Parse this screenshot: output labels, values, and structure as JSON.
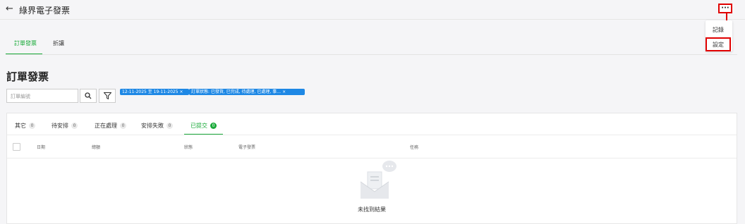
{
  "header": {
    "back_icon": "arrow-left-icon",
    "title": "綠界電子發票",
    "more_icon": "ellipsis-icon",
    "more_label": "···"
  },
  "dropdown": {
    "items": [
      "記錄",
      "設定"
    ]
  },
  "main_tabs": [
    {
      "label": "訂單發票",
      "active": true
    },
    {
      "label": "折讓",
      "active": false
    }
  ],
  "page_title": "訂單發票",
  "search": {
    "placeholder": "訂單編號"
  },
  "filters": [
    "12-11-2025 至 19-11-2025 ×",
    "訂單狀態: 已發貨, 已完成, 待處理, 已處理, 事… ×"
  ],
  "status_tabs": [
    {
      "label": "其它",
      "count": "0"
    },
    {
      "label": "待安排",
      "count": "0"
    },
    {
      "label": "正在處理",
      "count": "0"
    },
    {
      "label": "安排失敗",
      "count": "0"
    },
    {
      "label": "已提交",
      "count": "0",
      "active": true
    }
  ],
  "table": {
    "columns": [
      "日期",
      "總額",
      "狀態",
      "電子發票",
      "任務"
    ]
  },
  "empty_state": {
    "text": "未找到結果"
  },
  "colors": {
    "accent_green": "#1aaa3a",
    "chip_blue": "#1e88e5",
    "highlight_red": "#e00000"
  }
}
